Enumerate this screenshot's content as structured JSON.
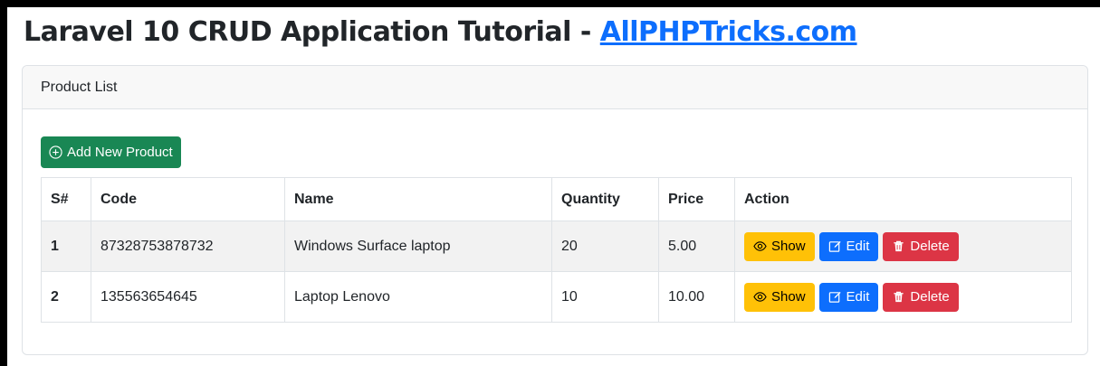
{
  "header": {
    "title_prefix": "Laravel 10 CRUD Application Tutorial - ",
    "title_link": "AllPHPTricks.com"
  },
  "card": {
    "header_label": "Product List",
    "add_button_label": "Add New Product"
  },
  "table": {
    "columns": [
      "S#",
      "Code",
      "Name",
      "Quantity",
      "Price",
      "Action"
    ],
    "rows": [
      {
        "sn": "1",
        "code": "87328753878732",
        "name": "Windows Surface laptop",
        "quantity": "20",
        "price": "5.00"
      },
      {
        "sn": "2",
        "code": "135563654645",
        "name": "Laptop Lenovo",
        "quantity": "10",
        "price": "10.00"
      }
    ],
    "actions": {
      "show": "Show",
      "edit": "Edit",
      "delete": "Delete"
    }
  },
  "icons": {
    "add": "plus-circle-icon",
    "show": "eye-icon",
    "edit": "pencil-square-icon",
    "delete": "trash-icon"
  },
  "colors": {
    "primary": "#0d6efd",
    "success": "#198754",
    "warning": "#ffc107",
    "danger": "#dc3545"
  }
}
